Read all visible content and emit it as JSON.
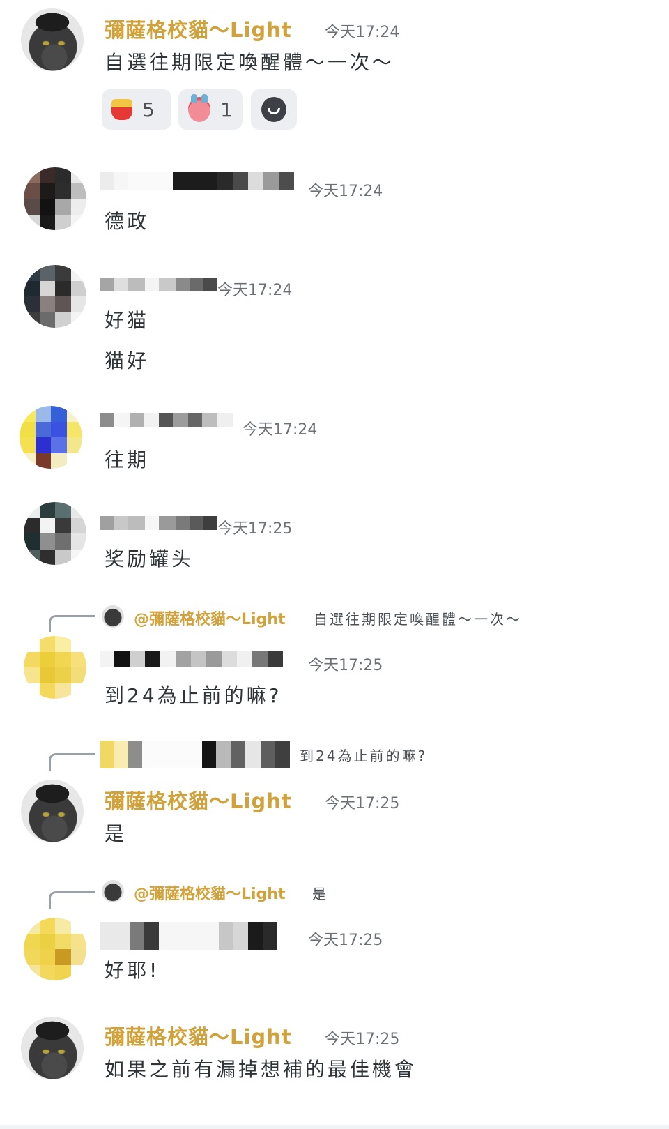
{
  "messages": [
    {
      "name": "彌薩格校貓～Light",
      "time": "今天17:24",
      "lines": [
        "自選往期限定喚醒體～一次～"
      ]
    },
    {
      "time": "今天17:24",
      "lines": [
        "德政"
      ]
    },
    {
      "time": "今天17:24",
      "lines": [
        "好猫",
        "猫好"
      ]
    },
    {
      "time": "今天17:24",
      "lines": [
        "往期"
      ]
    },
    {
      "time": "今天17:25",
      "lines": [
        "奖励罐头"
      ]
    },
    {
      "reply_to": {
        "name": "@彌薩格校貓～Light",
        "text": "自選往期限定喚醒體～一次～"
      },
      "time": "今天17:25",
      "lines": [
        "到24為止前的嘛?"
      ]
    },
    {
      "reply_to": {
        "text": "到24為止前的嘛?"
      },
      "name": "彌薩格校貓～Light",
      "time": "今天17:25",
      "lines": [
        "是"
      ]
    },
    {
      "reply_to": {
        "name": "@彌薩格校貓～Light",
        "text": "是"
      },
      "time": "今天17:25",
      "lines": [
        "好耶!"
      ]
    },
    {
      "name": "彌薩格校貓～Light",
      "time": "今天17:25",
      "lines": [
        "如果之前有漏掉想補的最佳機會"
      ]
    }
  ],
  "reactions": [
    {
      "icon": "fries-emoji-icon",
      "count": "5"
    },
    {
      "icon": "devil-emoji-icon",
      "count": "1"
    },
    {
      "icon": "add-reaction-icon"
    }
  ],
  "colors": {
    "username": "#d2a23a",
    "timestamp": "#6b6f76",
    "text": "#2e3338",
    "reaction_bg": "#eceef2"
  }
}
